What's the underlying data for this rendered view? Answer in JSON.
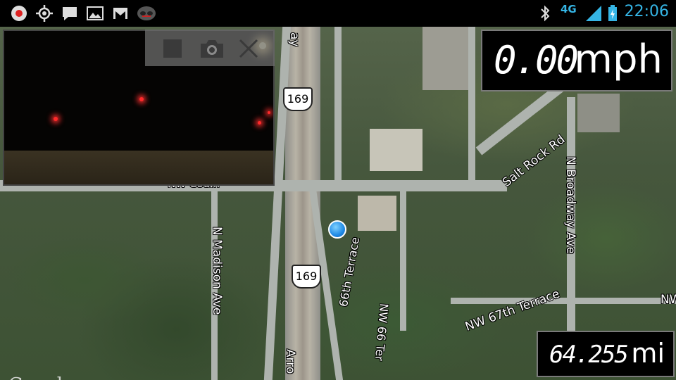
{
  "status_bar": {
    "time": "22:06",
    "network": "4G",
    "left_icons": [
      "record-icon",
      "gps-icon",
      "message-icon",
      "image-icon",
      "gmail-icon",
      "voicemail-icon"
    ],
    "right_icons": [
      "bluetooth-icon",
      "signal-icon",
      "battery-charging-icon"
    ],
    "accent_color": "#35b5e5"
  },
  "map": {
    "attribution": "Google",
    "labels": {
      "highway_top": "ay",
      "highway_bottom": "Arro",
      "cross_street_left": "NW Cou...",
      "salt_rock": "Salt Rock Rd",
      "n_broadway": "N Broadway Ave",
      "n_madison": "N Madison Ave",
      "nw_67th_terrace": "NW 67th Terrace",
      "sixty_sixth_terrace": "66th Terrace",
      "nw_66_ter": "NW 66 Ter",
      "nw_right": "NW"
    },
    "shields": {
      "upper": "169",
      "lower": "169"
    }
  },
  "camera": {
    "controls": [
      "stop-button",
      "camera-button",
      "close-button"
    ]
  },
  "speed": {
    "value": "0.00",
    "unit": "mph"
  },
  "distance": {
    "value": "64.255",
    "unit": "mi"
  }
}
